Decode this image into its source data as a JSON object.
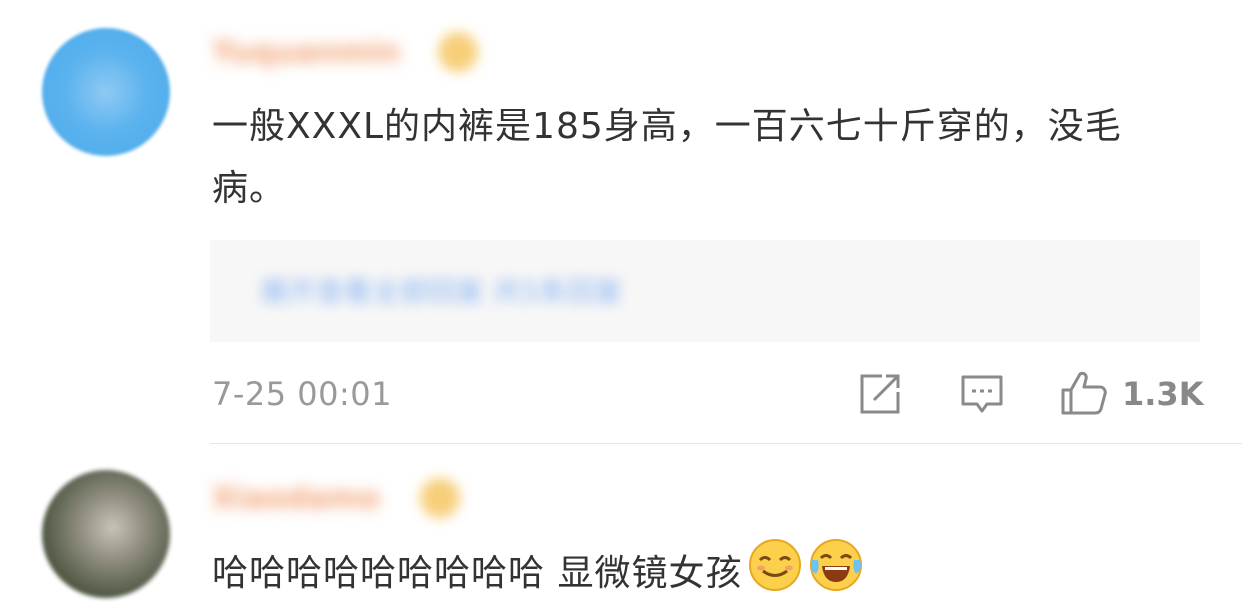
{
  "comments": [
    {
      "username": "Yuquanmin",
      "text": "一般XXXL的内裤是185身高，一百六七十斤穿的，没毛病。",
      "quote": "展开查看全部回复 共5条回复",
      "timestamp": "7-25 00:01",
      "like_count": "1.3K"
    },
    {
      "username": "Xiaodamo",
      "text": "哈哈哈哈哈哈哈哈哈 显微镜女孩"
    }
  ],
  "icons": {
    "share": "share-icon",
    "comment": "comment-icon",
    "like": "thumbs-up-icon",
    "emoji1": "smirk-emoji-icon",
    "emoji2": "laugh-cry-emoji-icon"
  },
  "colors": {
    "username": "#f2a67a",
    "link": "#8ab4f2",
    "meta": "#999999",
    "text": "#333333"
  }
}
